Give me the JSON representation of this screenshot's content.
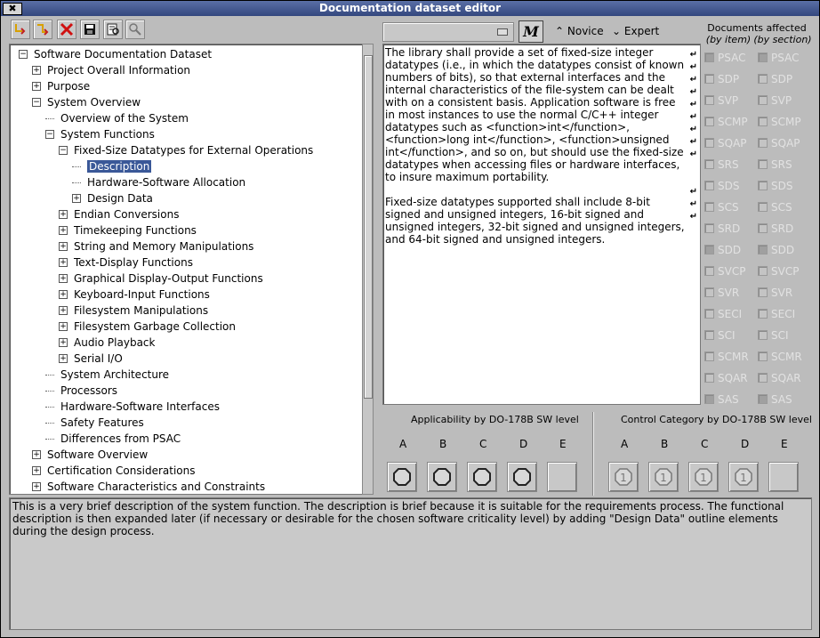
{
  "window": {
    "title": "Documentation dataset editor",
    "close_label": "✖"
  },
  "toolbar": {
    "icons": [
      "add-sibling-icon",
      "add-child-icon",
      "delete-icon",
      "save-icon",
      "preview-icon",
      "search-icon"
    ]
  },
  "tree": {
    "nodes": [
      {
        "label": "Software Documentation Dataset",
        "level": 0,
        "expander": "−"
      },
      {
        "label": "Project Overall Information",
        "level": 1,
        "expander": "+"
      },
      {
        "label": "Purpose",
        "level": 1,
        "expander": "+"
      },
      {
        "label": "System Overview",
        "level": 1,
        "expander": "−"
      },
      {
        "label": "Overview of the System",
        "level": 2,
        "expander": ""
      },
      {
        "label": "System Functions",
        "level": 2,
        "expander": "−"
      },
      {
        "label": "Fixed-Size Datatypes for External Operations",
        "level": 3,
        "expander": "−"
      },
      {
        "label": "Description",
        "level": 4,
        "expander": "",
        "selected": true
      },
      {
        "label": "Hardware-Software Allocation",
        "level": 4,
        "expander": ""
      },
      {
        "label": "Design Data",
        "level": 4,
        "expander": "+"
      },
      {
        "label": "Endian Conversions",
        "level": 3,
        "expander": "+"
      },
      {
        "label": "Timekeeping Functions",
        "level": 3,
        "expander": "+"
      },
      {
        "label": "String and Memory Manipulations",
        "level": 3,
        "expander": "+"
      },
      {
        "label": "Text-Display Functions",
        "level": 3,
        "expander": "+"
      },
      {
        "label": "Graphical Display-Output Functions",
        "level": 3,
        "expander": "+"
      },
      {
        "label": "Keyboard-Input Functions",
        "level": 3,
        "expander": "+"
      },
      {
        "label": "Filesystem Manipulations",
        "level": 3,
        "expander": "+"
      },
      {
        "label": "Filesystem Garbage Collection",
        "level": 3,
        "expander": "+"
      },
      {
        "label": "Audio Playback",
        "level": 3,
        "expander": "+"
      },
      {
        "label": "Serial I/O",
        "level": 3,
        "expander": "+"
      },
      {
        "label": "System Architecture",
        "level": 2,
        "expander": ""
      },
      {
        "label": "Processors",
        "level": 2,
        "expander": ""
      },
      {
        "label": "Hardware-Software Interfaces",
        "level": 2,
        "expander": ""
      },
      {
        "label": "Safety Features",
        "level": 2,
        "expander": ""
      },
      {
        "label": "Differences from PSAC",
        "level": 2,
        "expander": ""
      },
      {
        "label": "Software Overview",
        "level": 1,
        "expander": "+"
      },
      {
        "label": "Certification Considerations",
        "level": 1,
        "expander": "+"
      },
      {
        "label": "Software Characteristics and Constraints",
        "level": 1,
        "expander": "+"
      }
    ]
  },
  "editor": {
    "dropdown_value": "",
    "m_button": "M",
    "mode_novice": "Novice",
    "mode_expert": "Expert",
    "paragraph1": "The library shall provide a set of fixed-size integer datatypes (i.e., in which the datatypes consist of known numbers of bits), so that external interfaces and the internal characteristics of the file-system can be dealt with on a consistent basis.  Application software is free in most instances to use the normal C/C++ integer datatypes such as <function>int</function>, <function>long int</function>, <function>unsigned int</function>, and so on, but should use the fixed-size datatypes when accessing files or hardware interfaces, to insure maximum portability.",
    "paragraph2": "Fixed-size datatypes supported shall include 8-bit signed and unsigned integers, 16-bit signed and unsigned integers, 32-bit signed and unsigned integers, and 64-bit signed and unsigned integers."
  },
  "documents": {
    "heading": "Documents affected",
    "by_item": "(by item)",
    "by_section": "(by section)",
    "items": [
      {
        "name": "PSAC",
        "item": true,
        "section": true
      },
      {
        "name": "SDP",
        "item": false,
        "section": false
      },
      {
        "name": "SVP",
        "item": false,
        "section": false
      },
      {
        "name": "SCMP",
        "item": false,
        "section": false
      },
      {
        "name": "SQAP",
        "item": false,
        "section": false
      },
      {
        "name": "SRS",
        "item": false,
        "section": false
      },
      {
        "name": "SDS",
        "item": false,
        "section": false
      },
      {
        "name": "SCS",
        "item": false,
        "section": false
      },
      {
        "name": "SRD",
        "item": false,
        "section": false
      },
      {
        "name": "SDD",
        "item": true,
        "section": true
      },
      {
        "name": "SVCP",
        "item": false,
        "section": false
      },
      {
        "name": "SVR",
        "item": false,
        "section": false
      },
      {
        "name": "SECI",
        "item": false,
        "section": false
      },
      {
        "name": "SCI",
        "item": false,
        "section": false
      },
      {
        "name": "SCMR",
        "item": false,
        "section": false
      },
      {
        "name": "SQAR",
        "item": false,
        "section": false
      },
      {
        "name": "SAS",
        "item": true,
        "section": true
      }
    ]
  },
  "applicability": {
    "title": "Applicability by DO-178B SW level",
    "levels": [
      "A",
      "B",
      "C",
      "D",
      "E"
    ]
  },
  "control": {
    "title": "Control Category by DO-178B SW level",
    "levels": [
      "A",
      "B",
      "C",
      "D",
      "E"
    ],
    "badge": "1"
  },
  "description": "This is a very brief description of the system function.  The description is brief because it is suitable for the requirements process.  The functional description is then expanded later (if necessary or desirable for the chosen software criticality level) by adding \"Design Data\" outline elements during the design process."
}
